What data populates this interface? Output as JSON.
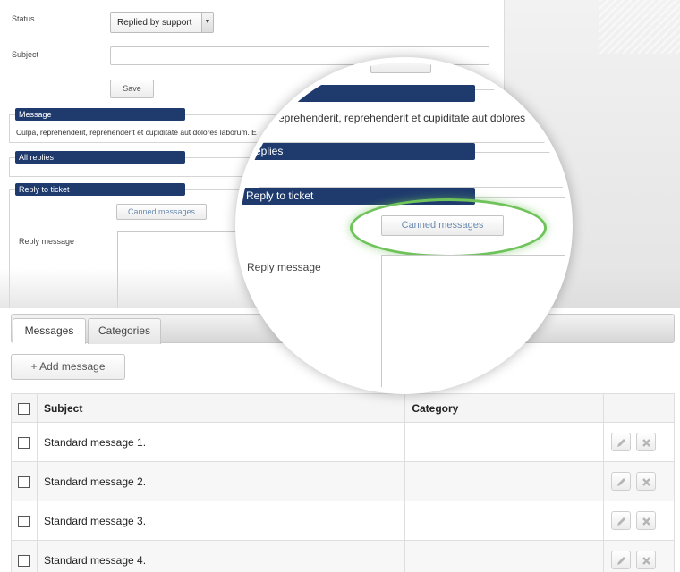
{
  "form": {
    "status_label": "Status",
    "status_value": "Replied by support",
    "subject_label": "Subject",
    "save_label": "Save",
    "message_legend": "Message",
    "message_text": "Culpa, reprehenderit, reprehenderit et cupiditate aut dolores laborum. E",
    "all_replies_legend": "All replies",
    "reply_legend": "Reply to ticket",
    "canned_label": "Canned messages",
    "reply_message_label": "Reply message"
  },
  "magnifier": {
    "message_text": "eprehenderit, reprehenderit et cupiditate aut dolores",
    "all_replies_legend": "l replies",
    "reply_legend": "Reply to ticket",
    "canned_label": "Canned messages",
    "reply_message_label": "Reply message",
    "highlight_color": "#6fc35a"
  },
  "panel": {
    "tabs": [
      {
        "label": "Messages",
        "active": true
      },
      {
        "label": "Categories",
        "active": false
      }
    ],
    "add_button_label": "+ Add message",
    "table": {
      "headers": {
        "subject": "Subject",
        "category": "Category"
      },
      "rows": [
        {
          "subject": "Standard message 1.",
          "category": ""
        },
        {
          "subject": "Standard message 2.",
          "category": ""
        },
        {
          "subject": "Standard message 3.",
          "category": ""
        },
        {
          "subject": "Standard message 4.",
          "category": ""
        }
      ]
    }
  },
  "colors": {
    "legend_bg": "#1f3b6e",
    "highlight": "#6fc35a"
  },
  "icons": [
    "chevron-down-icon",
    "pencil-icon",
    "close-icon"
  ]
}
